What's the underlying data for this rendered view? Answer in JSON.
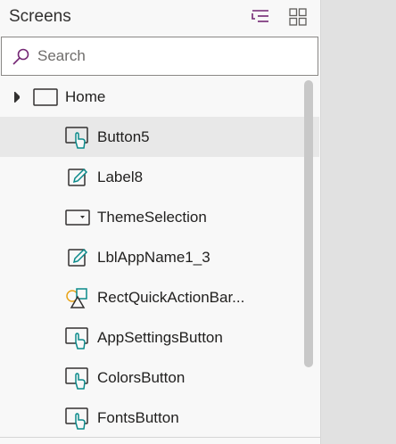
{
  "panel": {
    "title": "Screens",
    "tree_view_icon": "tree-view-icon",
    "grid_view_icon": "grid-view-icon"
  },
  "search": {
    "placeholder": "Search",
    "value": "",
    "icon": "search-icon"
  },
  "tree": {
    "root": {
      "label": "Home",
      "icon": "screen-icon",
      "expanded": true
    },
    "items": [
      {
        "label": "Button5",
        "icon": "button-icon",
        "selected": true
      },
      {
        "label": "Label8",
        "icon": "label-icon",
        "selected": false
      },
      {
        "label": "ThemeSelection",
        "icon": "dropdown-icon",
        "selected": false
      },
      {
        "label": "LblAppName1_3",
        "icon": "label-icon",
        "selected": false
      },
      {
        "label": "RectQuickActionBar...",
        "icon": "shapes-icon",
        "selected": false
      },
      {
        "label": "AppSettingsButton",
        "icon": "button-icon",
        "selected": false
      },
      {
        "label": "ColorsButton",
        "icon": "button-icon",
        "selected": false
      },
      {
        "label": "FontsButton",
        "icon": "button-icon",
        "selected": false
      }
    ]
  },
  "colors": {
    "accent": "#742774",
    "selected_row": "#e8e8e8",
    "icon_stroke": "#323130",
    "control_accent": "#0b8a8a"
  }
}
